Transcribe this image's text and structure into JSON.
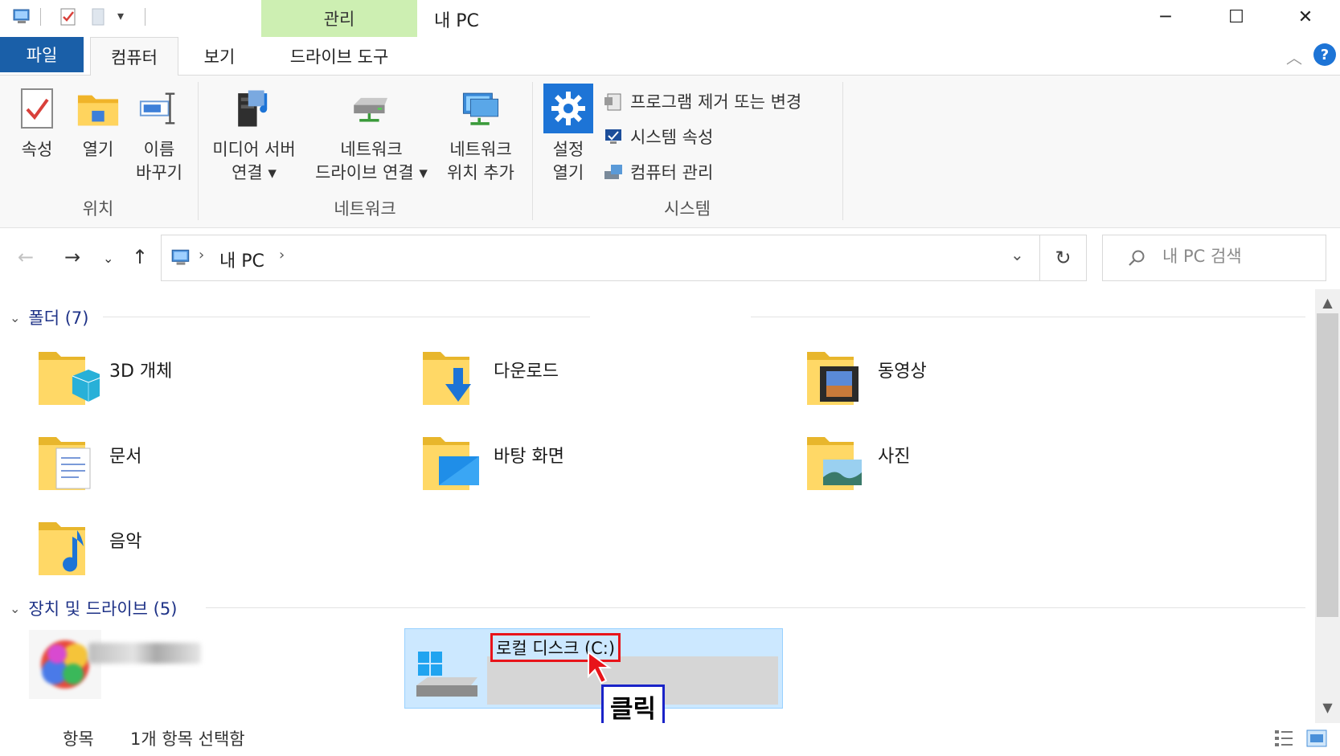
{
  "titlebar": {
    "manage_tab": "관리",
    "window_title": "내 PC",
    "minimize": "─",
    "maximize": "☐",
    "close": "✕"
  },
  "tabs": {
    "file": "파일",
    "computer": "컴퓨터",
    "view": "보기",
    "drive_tools": "드라이브 도구"
  },
  "ribbon": {
    "properties": "속성",
    "open": "열기",
    "rename_1": "이름",
    "rename_2": "바꾸기",
    "location_group": "위치",
    "media_server_1": "미디어 서버",
    "media_server_2": "연결 ▾",
    "map_drive_1": "네트워크",
    "map_drive_2": "드라이브 연결 ▾",
    "add_location_1": "네트워크",
    "add_location_2": "위치 추가",
    "network_group": "네트워크",
    "settings_1": "설정",
    "settings_2": "열기",
    "uninstall": "프로그램 제거 또는 변경",
    "system_properties": "시스템 속성",
    "computer_management": "컴퓨터 관리",
    "system_group": "시스템"
  },
  "address": {
    "path_item": "내 PC",
    "search_placeholder": "내 PC 검색"
  },
  "folders_section": {
    "label": "폴더 (7)",
    "items": [
      "3D 개체",
      "다운로드",
      "동영상",
      "문서",
      "바탕 화면",
      "사진",
      "음악"
    ]
  },
  "drives_section": {
    "label": "장치 및 드라이브 (5)",
    "local_disk": "로컬 디스크 (C:)",
    "annotation": "클릭"
  },
  "status": {
    "items": "항목",
    "selected": "1개 항목 선택함"
  },
  "colors": {
    "file_tab": "#1a5fa8",
    "manage_tab": "#cdefb2",
    "selection": "#cce8ff",
    "highlight_box": "#e8141a",
    "annotation_box": "#1a23c8"
  }
}
